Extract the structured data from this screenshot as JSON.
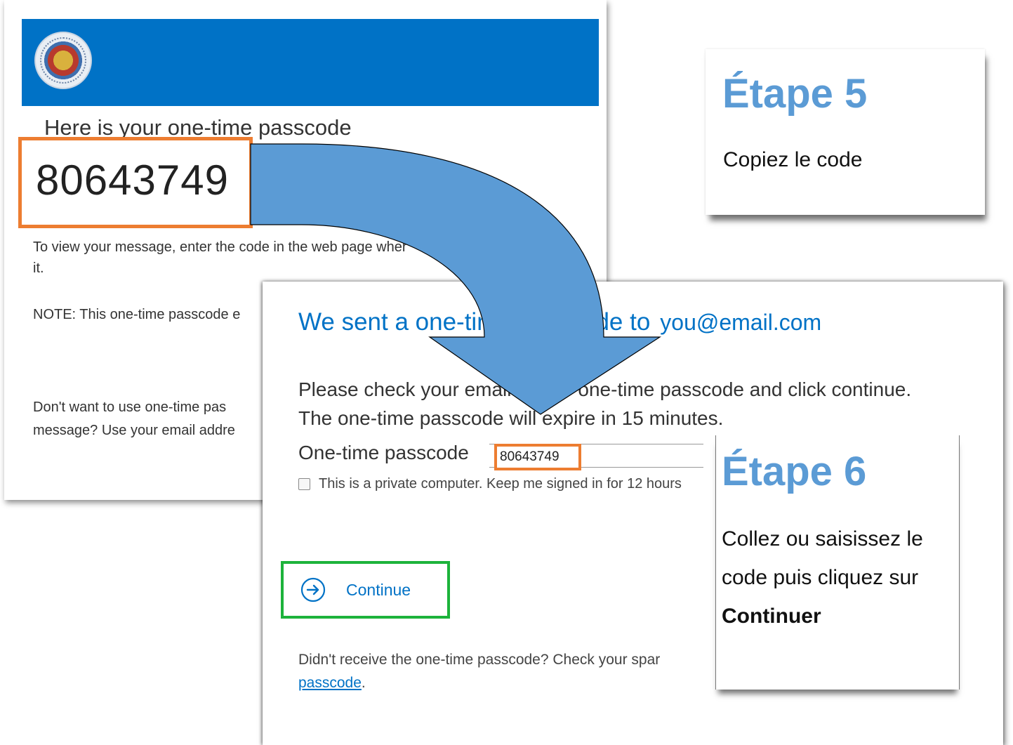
{
  "email": {
    "heading": "Here is your one-time passcode",
    "passcode": "80643749",
    "body_line1": "To view your message, enter the code in the web page wher",
    "body_line2": "it.",
    "note": "NOTE: This one-time passcode e",
    "alt_line1": "Don't want to use one-time pas",
    "alt_line2": "message? Use your email addre",
    "header_color": "#0072c6"
  },
  "signin": {
    "heading": "We sent a one-time passcode to",
    "email": "you@email.com",
    "instructions_line1": "Please check your email for the one-time passcode and click continue.",
    "instructions_line2": "The one-time passcode will expire in 15 minutes.",
    "otp_label": "One-time passcode",
    "otp_value": "80643749",
    "remember_label": "This is a private computer. Keep me signed in for 12 hours",
    "continue_label": "Continue",
    "didnt_receive": "Didn't receive the one-time passcode? Check your spar",
    "passcode_link": "passcode",
    "link_suffix": "."
  },
  "step5": {
    "title": "Étape 5",
    "text": "Copiez le code"
  },
  "step6": {
    "title": "Étape 6",
    "text_line1": "Collez ou saisissez le",
    "text_line2": "code puis cliquez sur",
    "text_bold": "Continuer"
  },
  "colors": {
    "accent_blue": "#0072c6",
    "highlight_orange": "#ed7d31",
    "highlight_green": "#1db33b",
    "arrow_blue": "#5b9bd5",
    "step_title_blue": "#5b9bd5"
  },
  "icons": [
    "seal-logo",
    "arrow-right-circle-icon",
    "curved-arrow"
  ]
}
